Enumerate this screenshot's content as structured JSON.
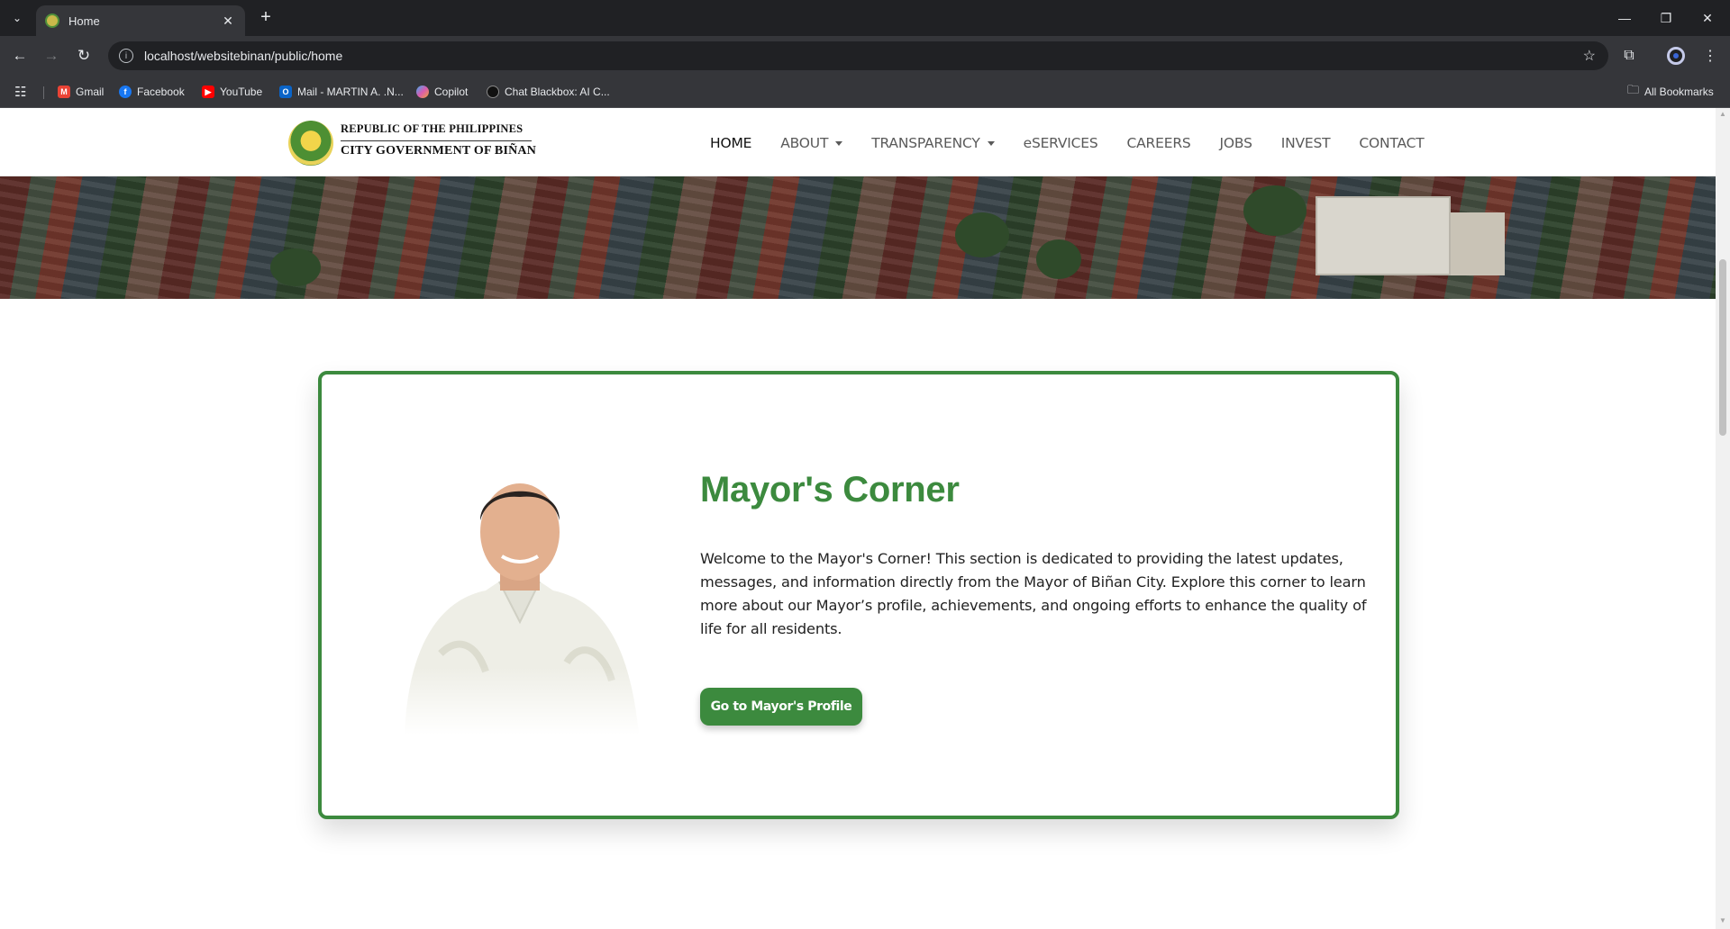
{
  "browser": {
    "tab_title": "Home",
    "new_tab_label": "+",
    "url": "localhost/websitebinan/public/home",
    "bookmarks": [
      {
        "label": "Gmail",
        "icon": "gmail-icon",
        "color": "#ea4335"
      },
      {
        "label": "Facebook",
        "icon": "facebook-icon",
        "color": "#1877f2"
      },
      {
        "label": "YouTube",
        "icon": "youtube-icon",
        "color": "#ff0000"
      },
      {
        "label": "Mail - MARTIN A. .N...",
        "icon": "outlook-icon",
        "color": "#0a64c8"
      },
      {
        "label": "Copilot",
        "icon": "copilot-icon",
        "color": "#7b5cd6"
      },
      {
        "label": "Chat Blackbox: AI C...",
        "icon": "blackbox-icon",
        "color": "#111111"
      }
    ],
    "all_bookmarks_label": "All Bookmarks"
  },
  "site": {
    "logo_line1": "REPUBLIC OF THE PHILIPPINES",
    "logo_line2": "CITY GOVERNMENT OF BIÑAN",
    "nav": [
      {
        "label": "HOME",
        "active": true,
        "dropdown": false
      },
      {
        "label": "ABOUT",
        "active": false,
        "dropdown": true
      },
      {
        "label": "TRANSPARENCY",
        "active": false,
        "dropdown": true
      },
      {
        "label": "eSERVICES",
        "active": false,
        "dropdown": false
      },
      {
        "label": "CAREERS",
        "active": false,
        "dropdown": false
      },
      {
        "label": "JOBS",
        "active": false,
        "dropdown": false
      },
      {
        "label": "INVEST",
        "active": false,
        "dropdown": false
      },
      {
        "label": "CONTACT",
        "active": false,
        "dropdown": false
      }
    ]
  },
  "mayors_corner": {
    "title": "Mayor's Corner",
    "body": "Welcome to the Mayor's Corner! This section is dedicated to providing the latest updates, messages, and information directly from the Mayor of Biñan City. Explore this corner to learn more about our Mayor’s profile, achievements, and ongoing efforts to enhance the quality of life for all residents.",
    "button_label": "Go to Mayor's Profile"
  },
  "colors": {
    "accent_green": "#3c8a3e",
    "chrome_dark": "#202124",
    "chrome_toolbar": "#35363a"
  }
}
